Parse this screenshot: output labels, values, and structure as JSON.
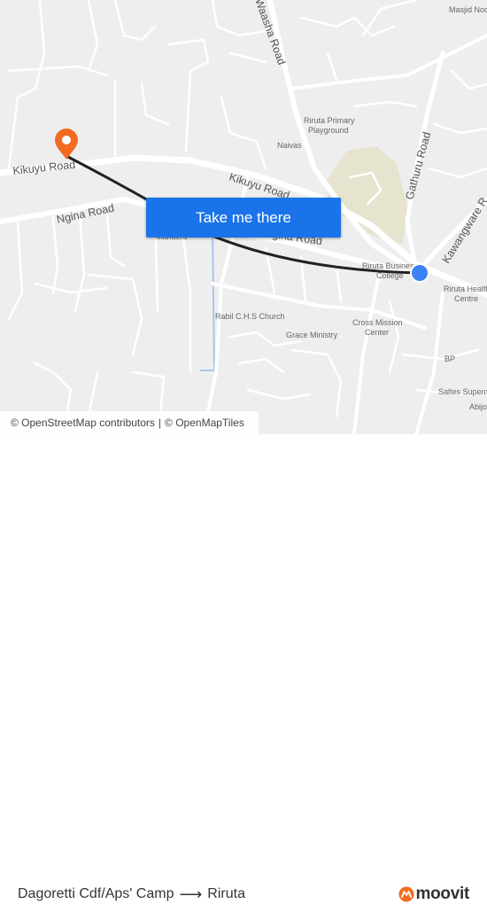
{
  "map": {
    "roads": {
      "kikuyu_west": "Kikuyu Road",
      "kikuyu_east": "Kikuyu Road",
      "ngina_west": "Ngina Road",
      "ngina_east": "Ngina Road",
      "washa": "Waasha Road",
      "gathuru": "Gathuru Road",
      "kawangware": "Kawangware R"
    },
    "pois": {
      "masjid": "Masjid Noo",
      "riruta_primary_1": "Riruta Primary",
      "riruta_primary_2": "Playground",
      "naivas": "Naivas",
      "riruta_business_1": "Riruta Business",
      "riruta_business_2": "College",
      "riruta_health_1": "Riruta Health",
      "riruta_health_2": "Centre",
      "manderu": "Manderu",
      "rabil_church": "Rabil C.H.S Church",
      "cross_mission_1": "Cross Mission",
      "cross_mission_2": "Center",
      "grace_ministry": "Grace Ministry",
      "bp": "BP",
      "saltes": "Saltes Superm",
      "abijo": "Abijo"
    },
    "cta_label": "Take me there",
    "attribution": {
      "osm_contrib": "© OpenStreetMap contributors",
      "separator": "|",
      "osm_tiles": "© OpenMapTiles"
    },
    "colors": {
      "route": "#222222",
      "origin_pin": "#f26b21",
      "destination_dot": "#3b82f6",
      "button": "#1a73e8",
      "park": "#e6e3cf"
    }
  },
  "footer": {
    "origin": "Dagoretti Cdf/Aps' Camp",
    "destination": "Riruta",
    "brand": "moovit",
    "arrow_icon": "right-arrow-icon",
    "brand_icon": "moovit-logo-icon"
  }
}
